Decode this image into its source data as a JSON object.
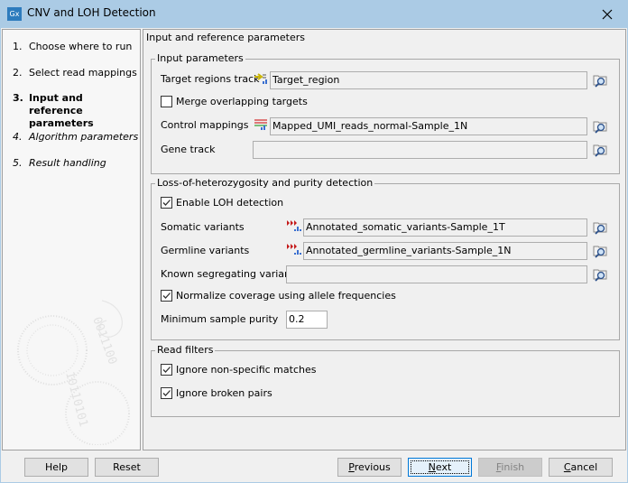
{
  "window": {
    "title": "CNV and LOH Detection",
    "app_icon_label": "Gx",
    "close_icon": "close-icon"
  },
  "steps": [
    {
      "num": "1.",
      "label": "Choose where to run",
      "state": "done"
    },
    {
      "num": "2.",
      "label": "Select read mappings",
      "state": "done"
    },
    {
      "num": "3.",
      "label": "Input and reference parameters",
      "label_line1": "Input and reference",
      "label_line2": "parameters",
      "state": "current"
    },
    {
      "num": "4.",
      "label": "Algorithm parameters",
      "state": "future"
    },
    {
      "num": "5.",
      "label": "Result handling",
      "state": "future"
    }
  ],
  "main": {
    "heading": "Input and reference parameters",
    "input_parameters": {
      "legend": "Input parameters",
      "target_regions_track": {
        "label": "Target regions track",
        "value": "Target_region",
        "icon": "track-icon"
      },
      "merge_overlapping": {
        "label": "Merge overlapping targets",
        "checked": false
      },
      "control_mappings": {
        "label": "Control mappings",
        "value": "Mapped_UMI_reads_normal-Sample_1N",
        "icon": "mapping-icon"
      },
      "gene_track": {
        "label": "Gene track",
        "value": ""
      }
    },
    "loh": {
      "legend": "Loss-of-heterozygosity and purity detection",
      "enable_loh": {
        "label": "Enable LOH detection",
        "checked": true
      },
      "somatic_variants": {
        "label": "Somatic variants",
        "value": "Annotated_somatic_variants-Sample_1T",
        "icon": "variant-track-icon"
      },
      "germline_variants": {
        "label": "Germline variants",
        "value": "Annotated_germline_variants-Sample_1N",
        "icon": "variant-track-icon"
      },
      "known_segregating": {
        "label": "Known segregating variants",
        "value": ""
      },
      "normalize_coverage": {
        "label": "Normalize coverage using allele frequencies",
        "checked": true
      },
      "min_purity": {
        "label": "Minimum sample purity",
        "value": "0.2"
      }
    },
    "read_filters": {
      "legend": "Read filters",
      "ignore_nonspecific": {
        "label": "Ignore non-specific matches",
        "checked": true
      },
      "ignore_broken": {
        "label": "Ignore broken pairs",
        "checked": true
      }
    }
  },
  "footer": {
    "help": "Help",
    "reset": "Reset",
    "previous": {
      "mnemonic": "P",
      "rest": "revious"
    },
    "next": {
      "mnemonic": "N",
      "rest": "ext"
    },
    "finish": {
      "mnemonic": "F",
      "rest": "inish",
      "disabled": true
    },
    "cancel": {
      "mnemonic": "C",
      "rest": "ancel"
    }
  }
}
